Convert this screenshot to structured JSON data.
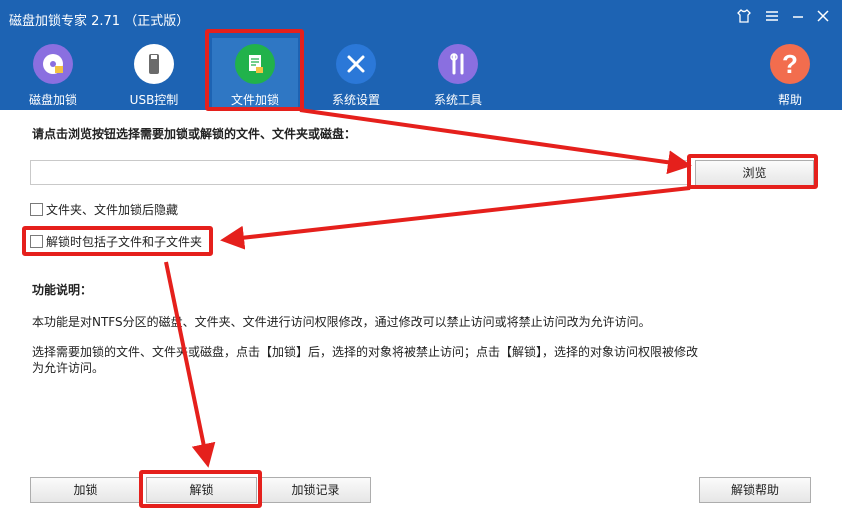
{
  "window": {
    "title": "磁盘加锁专家 2.71 （正式版）"
  },
  "toolbar": {
    "items": [
      {
        "label": "磁盘加锁",
        "icon": "disk-lock-icon",
        "color": "#8a6fe0"
      },
      {
        "label": "USB控制",
        "icon": "usb-icon",
        "color": "#ffffff"
      },
      {
        "label": "文件加锁",
        "icon": "file-lock-icon",
        "color": "#21b24b",
        "active": true
      },
      {
        "label": "系统设置",
        "icon": "settings-tools-icon",
        "color": "#2b78d8"
      },
      {
        "label": "系统工具",
        "icon": "toolkit-icon",
        "color": "#8a6fe0"
      },
      {
        "label": "帮助",
        "icon": "help-icon",
        "color": "#f26d4e"
      }
    ]
  },
  "main": {
    "prompt": "请点击浏览按钮选择需要加锁或解锁的文件、文件夹或磁盘：",
    "path_value": "",
    "browse_label": "浏览",
    "check_hide_label": "文件夹、文件加锁后隐藏",
    "check_sub_label": "解锁时包括子文件和子文件夹",
    "func_title": "功能说明：",
    "func_p1": "本功能是对NTFS分区的磁盘、文件夹、文件进行访问权限修改，通过修改可以禁止访问或将禁止访问改为允许访问。",
    "func_p2": "选择需要加锁的文件、文件夹或磁盘，点击【加锁】后，选择的对象将被禁止访问；点击【解锁】，选择的对象访问权限被修改为允许访问。"
  },
  "buttons": {
    "lock": "加锁",
    "unlock": "解锁",
    "lock_log": "加锁记录",
    "unlock_help": "解锁帮助"
  },
  "colors": {
    "titlebar": "#1d63b3",
    "highlight": "#e5201c"
  }
}
